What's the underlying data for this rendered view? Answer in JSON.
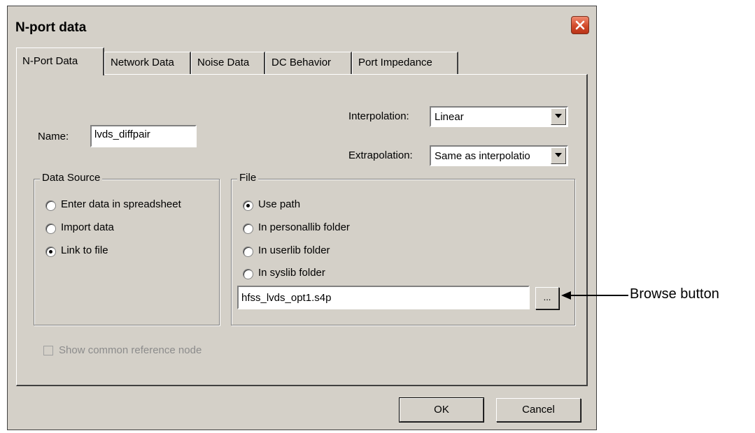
{
  "window": {
    "title": "N-port data"
  },
  "tabs": [
    {
      "label": "N-Port Data"
    },
    {
      "label": "Network Data"
    },
    {
      "label": "Noise Data"
    },
    {
      "label": "DC Behavior"
    },
    {
      "label": "Port Impedance"
    }
  ],
  "name": {
    "label": "Name:",
    "value": "lvds_diffpair"
  },
  "interpolation": {
    "label": "Interpolation:",
    "value": "Linear"
  },
  "extrapolation": {
    "label": "Extrapolation:",
    "value": "Same as interpolatio"
  },
  "data_source": {
    "title": "Data Source",
    "options": [
      {
        "label": "Enter data in spreadsheet",
        "selected": false
      },
      {
        "label": "Import data",
        "selected": false
      },
      {
        "label": "Link to file",
        "selected": true
      }
    ]
  },
  "file": {
    "title": "File",
    "options": [
      {
        "label": "Use path",
        "selected": true
      },
      {
        "label": "In personallib folder",
        "selected": false
      },
      {
        "label": "In userlib folder",
        "selected": false
      },
      {
        "label": "In syslib folder",
        "selected": false
      }
    ],
    "path_value": "hfss_lvds_opt1.s4p",
    "browse_label": "..."
  },
  "show_common_reference": {
    "label": "Show common reference node",
    "checked": false,
    "disabled": true
  },
  "buttons": {
    "ok": "OK",
    "cancel": "Cancel"
  },
  "annotation": {
    "label": "Browse button"
  }
}
